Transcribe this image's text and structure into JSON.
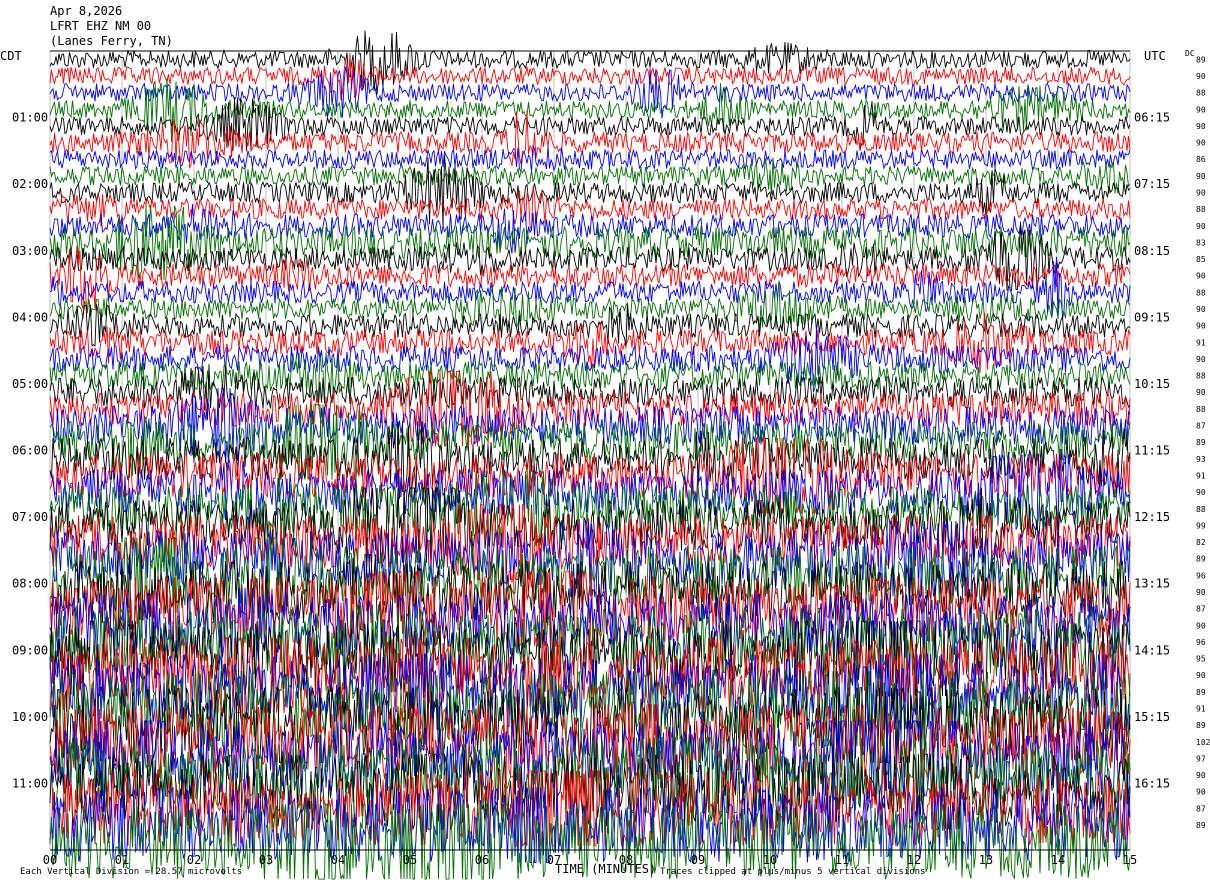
{
  "header": {
    "date": "Apr 8,2026",
    "station": "LFRT EHZ NM 00",
    "location": "(Lanes Ferry, TN)"
  },
  "left_axis_label": "CDT",
  "right_axis_label": "UTC",
  "dc_label": "DC",
  "footer": {
    "scale_note": "Each Vertical Division = 28.57 microvolts",
    "xlabel": "TIME (MINUTES)",
    "clip_note": "Traces clipped at plus/minus 5 vertical divisions"
  },
  "colors": {
    "trace_cycle": [
      "#000000",
      "#ff0000",
      "#0000ff",
      "#007000"
    ],
    "grid": "#bfbfbf"
  },
  "chart_data": {
    "type": "line",
    "title": "",
    "xlabel": "TIME (MINUTES)",
    "ylabel": "",
    "xlim": [
      0,
      15
    ],
    "x_ticks": [
      "00",
      "01",
      "02",
      "03",
      "04",
      "05",
      "06",
      "07",
      "08",
      "09",
      "10",
      "11",
      "12",
      "13",
      "14",
      "15"
    ],
    "row_count": 48,
    "row_minutes": 15,
    "left_ticks": [
      "01:00",
      "02:00",
      "03:00",
      "04:00",
      "05:00",
      "06:00",
      "07:00",
      "08:00",
      "09:00",
      "10:00",
      "11:00"
    ],
    "right_ticks": [
      "06:15",
      "07:15",
      "08:15",
      "09:15",
      "10:15",
      "11:15",
      "12:15",
      "13:15",
      "14:15",
      "15:15",
      "16:15"
    ],
    "dc_offsets": [
      89,
      90,
      88,
      90,
      90,
      90,
      86,
      90,
      90,
      88,
      90,
      83,
      85,
      90,
      88,
      90,
      90,
      91,
      90,
      88,
      90,
      88,
      87,
      89,
      93,
      91,
      90,
      88,
      99,
      82,
      89,
      96,
      90,
      87,
      90,
      96,
      95,
      90,
      89,
      91,
      89,
      102,
      97,
      90,
      90,
      87,
      89
    ],
    "amplitude_divisions": [
      1.2,
      1.2,
      1.2,
      1.2,
      1.3,
      1.4,
      1.3,
      1.3,
      1.4,
      1.4,
      1.6,
      2.2,
      1.6,
      1.6,
      1.5,
      1.4,
      1.6,
      1.7,
      1.8,
      1.9,
      2.1,
      2.3,
      2.6,
      2.8,
      2.9,
      3.0,
      3.1,
      3.2,
      3.4,
      3.6,
      3.8,
      4.0,
      4.2,
      4.4,
      4.5,
      4.7,
      4.8,
      5.0,
      5.0,
      5.0,
      5.0,
      5.0,
      5.0,
      5.0,
      5.0,
      5.0,
      5.0,
      5.0
    ]
  }
}
